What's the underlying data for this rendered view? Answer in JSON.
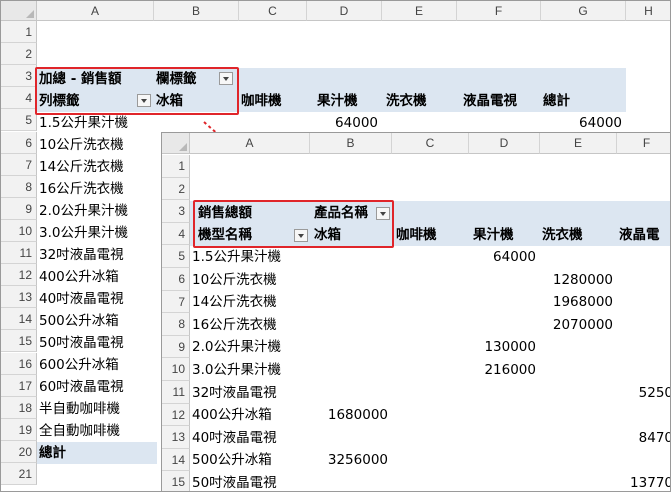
{
  "sheet1": {
    "col_headers": [
      "A",
      "B",
      "C",
      "D",
      "E",
      "F",
      "G",
      "H"
    ],
    "row_numbers": [
      "1",
      "2",
      "3",
      "4",
      "5",
      "6",
      "7",
      "8",
      "9",
      "10",
      "11",
      "12",
      "13",
      "14",
      "15",
      "16",
      "17",
      "18",
      "19",
      "20",
      "21"
    ],
    "values_label": "加總 - 銷售額",
    "column_labels": "欄標籤",
    "row_labels": "列標籤",
    "column_items": [
      "冰箱",
      "咖啡機",
      "果汁機",
      "洗衣機",
      "液晶電視",
      "總計"
    ],
    "rows": [
      {
        "label": "1.5公升果汁機",
        "juicer": "64000",
        "total": "64000"
      },
      {
        "label": "10公斤洗衣機"
      },
      {
        "label": "14公斤洗衣機"
      },
      {
        "label": "16公斤洗衣機"
      },
      {
        "label": "2.0公升果汁機"
      },
      {
        "label": "3.0公升果汁機"
      },
      {
        "label": "32吋液晶電視"
      },
      {
        "label": "400公升冰箱"
      },
      {
        "label": "40吋液晶電視"
      },
      {
        "label": "500公升冰箱"
      },
      {
        "label": "50吋液晶電視"
      },
      {
        "label": "600公升冰箱"
      },
      {
        "label": "60吋液晶電視"
      },
      {
        "label": "半自動咖啡機"
      },
      {
        "label": "全自動咖啡機"
      }
    ],
    "grand_total_label": "總計"
  },
  "sheet2": {
    "col_headers": [
      "A",
      "B",
      "C",
      "D",
      "E",
      "F"
    ],
    "row_numbers": [
      "1",
      "2",
      "3",
      "4",
      "5",
      "6",
      "7",
      "8",
      "9",
      "10",
      "11",
      "12",
      "13",
      "14",
      "15"
    ],
    "values_label": "銷售總額",
    "column_labels": "產品名稱",
    "row_labels": "機型名稱",
    "column_items": [
      "冰箱",
      "咖啡機",
      "果汁機",
      "洗衣機",
      "液晶電"
    ],
    "rows": [
      {
        "label": "1.5公升果汁機",
        "B": "",
        "D": "64000",
        "E": "",
        "F": ""
      },
      {
        "label": "10公斤洗衣機",
        "B": "",
        "D": "",
        "E": "1280000",
        "F": ""
      },
      {
        "label": "14公斤洗衣機",
        "B": "",
        "D": "",
        "E": "1968000",
        "F": ""
      },
      {
        "label": "16公斤洗衣機",
        "B": "",
        "D": "",
        "E": "2070000",
        "F": ""
      },
      {
        "label": "2.0公升果汁機",
        "B": "",
        "D": "130000",
        "E": "",
        "F": ""
      },
      {
        "label": "3.0公升果汁機",
        "B": "",
        "D": "216000",
        "E": "",
        "F": ""
      },
      {
        "label": "32吋液晶電視",
        "B": "",
        "D": "",
        "E": "",
        "F": "5250"
      },
      {
        "label": "400公升冰箱",
        "B": "1680000",
        "D": "",
        "E": "",
        "F": ""
      },
      {
        "label": "40吋液晶電視",
        "B": "",
        "D": "",
        "E": "",
        "F": "8470"
      },
      {
        "label": "500公升冰箱",
        "B": "3256000",
        "D": "",
        "E": "",
        "F": ""
      },
      {
        "label": "50吋液晶電視",
        "B": "",
        "D": "",
        "E": "",
        "F": "13770"
      }
    ]
  }
}
